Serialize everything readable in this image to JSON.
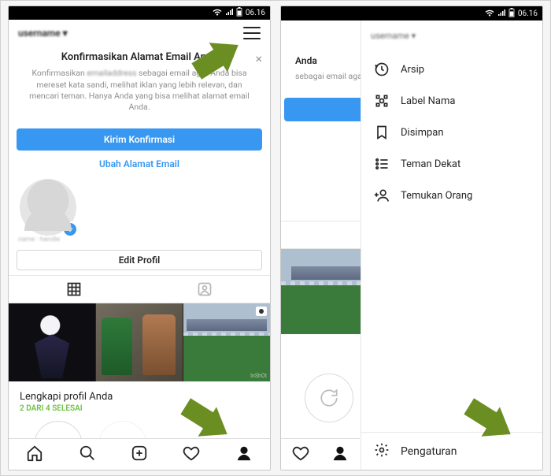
{
  "status": {
    "time": "06.16"
  },
  "header": {
    "username": "username ▾"
  },
  "banner": {
    "title": "Konfirmasikan Alamat Email Anda",
    "body_a": "Konfirmasikan",
    "body_b": "sebagai email agar Anda bisa mereset kata sandi, melihat iklan yang lebih relevan, dan mencari teman. Hanya Anda yang bisa melihat alamat email Anda.",
    "primary": "Kirim Konfirmasi",
    "secondary": "Ubah Alamat Email"
  },
  "edit_profile": "Edit Profil",
  "complete": {
    "title": "Lengkapi profil Anda",
    "subtitle": "2 DARI 4 SELESAI"
  },
  "right_partial": {
    "banner_body": "sebagai email agar yang lebih relevan, melihat alamat email"
  },
  "sidebar": {
    "items": [
      {
        "label": "Arsip"
      },
      {
        "label": "Label Nama"
      },
      {
        "label": "Disimpan"
      },
      {
        "label": "Teman Dekat"
      },
      {
        "label": "Temukan Orang"
      }
    ],
    "settings": "Pengaturan"
  }
}
